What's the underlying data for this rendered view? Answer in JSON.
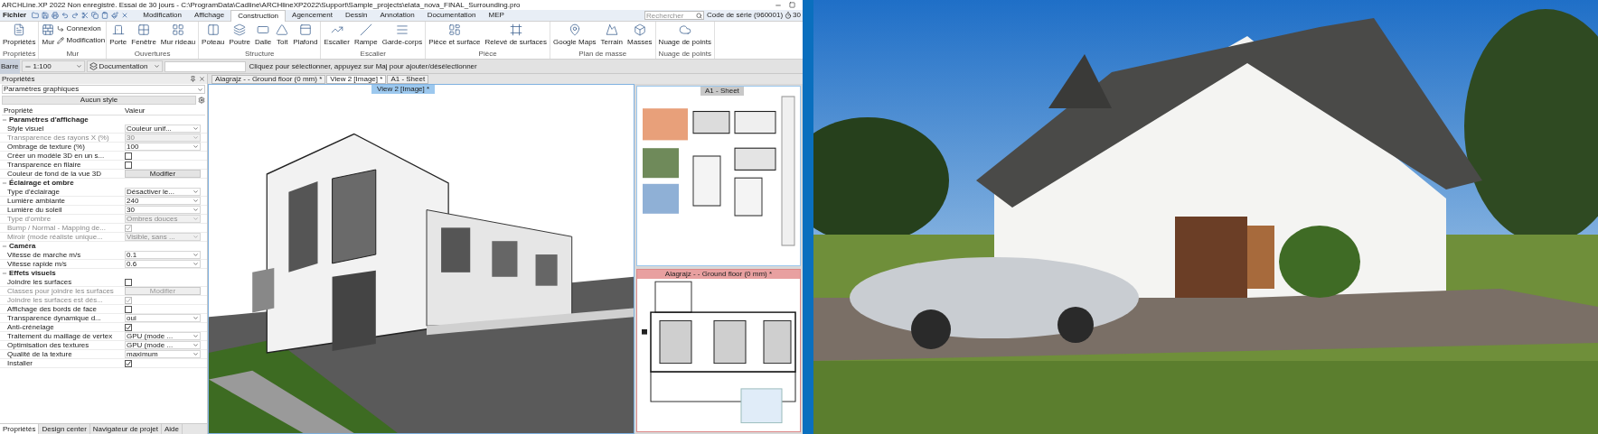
{
  "window": {
    "title": "ARCHLine.XP 2022 Non enregistré. Essai de 30 jours - C:\\ProgramData\\Cadline\\ARCHlineXP2022\\Support\\Sample_projects\\elata_nova_FINAL_Surrounding.pro"
  },
  "menu": {
    "file": "Fichier",
    "tabs": [
      {
        "label": "Modification",
        "selected": false
      },
      {
        "label": "Affichage",
        "selected": false
      },
      {
        "label": "Construction",
        "selected": true
      },
      {
        "label": "Agencement",
        "selected": false
      },
      {
        "label": "Dessin",
        "selected": false
      },
      {
        "label": "Annotation",
        "selected": false
      },
      {
        "label": "Documentation",
        "selected": false
      },
      {
        "label": "MEP",
        "selected": false
      }
    ],
    "search": {
      "placeholder": "Rechercher"
    },
    "serial": "Code de série (960001)",
    "timer": "30"
  },
  "ribbon": [
    {
      "label": "Propriétés",
      "tools": [
        "Propriétés"
      ]
    },
    {
      "label": "Mur",
      "tools": [
        "Mur"
      ],
      "small_tools": [
        "Connexion",
        "Modification"
      ]
    },
    {
      "label": "Ouvertures",
      "tools": [
        "Porte",
        "Fenêtre",
        "Mur rideau"
      ]
    },
    {
      "label": "Structure",
      "tools": [
        "Poteau",
        "Poutre",
        "Dalle",
        "Toit",
        "Plafond"
      ]
    },
    {
      "label": "Escalier",
      "tools": [
        "Escalier",
        "Rampe",
        "Garde-corps"
      ]
    },
    {
      "label": "Pièce",
      "tools": [
        "Pièce et surface",
        "Relevé de surfaces"
      ]
    },
    {
      "label": "Plan de masse",
      "tools": [
        "Google Maps",
        "Terrain",
        "Masses"
      ]
    },
    {
      "label": "Nuage de points",
      "tools": [
        "Nuage de points"
      ]
    }
  ],
  "toolbar": {
    "side_label": "Barre",
    "scale": "1:100",
    "layer": "Documentation",
    "hint": "Cliquez pour sélectionner, appuyez sur Maj pour ajouter/désélectionner"
  },
  "properties": {
    "title": "Propriétés",
    "category": "Paramètres graphiques",
    "style": "Aucun style",
    "columns": [
      "Propriété",
      "Valeur"
    ],
    "sections": [
      {
        "title": "Paramètres d'affichage",
        "rows": [
          {
            "kind": "dropdown",
            "name": "Style visuel",
            "value": "Couleur unif...",
            "disabled": false
          },
          {
            "kind": "dropdown",
            "name": "Transparence des rayons X (%)",
            "value": "30",
            "disabled": true
          },
          {
            "kind": "dropdown",
            "name": "Ombrage de texture (%)",
            "value": "100",
            "disabled": false
          },
          {
            "kind": "checkbox",
            "name": "Créer un modèle 3D en un s...",
            "checked": false,
            "disabled": false
          },
          {
            "kind": "checkbox",
            "name": "Transparence en filaire",
            "checked": false,
            "disabled": false
          },
          {
            "kind": "button",
            "name": "Couleur de fond de la vue 3D",
            "value": "Modifier",
            "disabled": false
          }
        ]
      },
      {
        "title": "Éclairage et ombre",
        "rows": [
          {
            "kind": "dropdown",
            "name": "Type d'éclairage",
            "value": "Désactiver le...",
            "disabled": false
          },
          {
            "kind": "dropdown",
            "name": "Lumière ambiante",
            "value": "240",
            "disabled": false
          },
          {
            "kind": "dropdown",
            "name": "Lumière du soleil",
            "value": "30",
            "disabled": false
          },
          {
            "kind": "dropdown",
            "name": "Type d'ombre",
            "value": "Ombres douces",
            "disabled": true
          },
          {
            "kind": "checkbox",
            "name": "Bump / Normal - Mapping de...",
            "checked": true,
            "disabled": true
          },
          {
            "kind": "dropdown",
            "name": "Miroir (mode réaliste unique...",
            "value": "Visible, sans ...",
            "disabled": true
          }
        ]
      },
      {
        "title": "Caméra",
        "rows": [
          {
            "kind": "dropdown",
            "name": "Vitesse de marche m/s",
            "value": "0.1",
            "disabled": false
          },
          {
            "kind": "dropdown",
            "name": "Vitesse rapide m/s",
            "value": "0.6",
            "disabled": false
          }
        ]
      },
      {
        "title": "Effets visuels",
        "rows": [
          {
            "kind": "checkbox",
            "name": "Joindre les surfaces",
            "checked": false,
            "disabled": false
          },
          {
            "kind": "button",
            "name": "Classes pour joindre les surfaces",
            "value": "Modifier",
            "disabled": true
          },
          {
            "kind": "checkbox",
            "name": "Joindre les surfaces est dés...",
            "checked": true,
            "disabled": true
          },
          {
            "kind": "checkbox",
            "name": "Affichage des bords de face",
            "checked": false,
            "disabled": false
          },
          {
            "kind": "dropdown",
            "name": "Transparence dynamique d...",
            "value": "oui",
            "disabled": false
          },
          {
            "kind": "checkbox",
            "name": "Anti-crénelage",
            "checked": true,
            "disabled": false
          },
          {
            "kind": "dropdown",
            "name": "Traitement du maillage de vertex",
            "value": "GPU (mode ...",
            "disabled": false
          },
          {
            "kind": "dropdown",
            "name": "Optimisation des textures",
            "value": "GPU (mode ...",
            "disabled": false
          },
          {
            "kind": "dropdown",
            "name": "Qualité de la texture",
            "value": "maximum",
            "disabled": false
          },
          {
            "kind": "checkbox",
            "name": "Installer",
            "checked": true,
            "disabled": false
          }
        ]
      }
    ]
  },
  "doc_tabs": [
    {
      "label": "Alagrajz - - Ground floor (0 mm) *",
      "selected": false
    },
    {
      "label": "View 2 [Image] *",
      "selected": true
    },
    {
      "label": "A1 - Sheet",
      "selected": false
    }
  ],
  "viewport": {
    "title": "View 2 [Image] *"
  },
  "sheet": {
    "title": "A1 - Sheet"
  },
  "plan": {
    "title": "Alagrajz - - Ground floor (0 mm) *"
  },
  "bottom_tabs": [
    {
      "label": "Propriétés",
      "selected": true
    },
    {
      "label": "Design center",
      "selected": false
    },
    {
      "label": "Navigateur de projet",
      "selected": false
    },
    {
      "label": "Aide",
      "selected": false
    }
  ]
}
